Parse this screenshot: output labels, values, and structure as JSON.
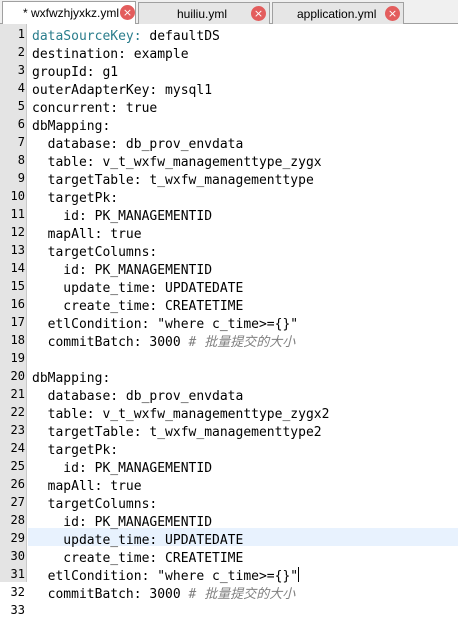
{
  "tabs": [
    {
      "label": "* wxfwzhjyxkz.yml",
      "close": "×",
      "active": true
    },
    {
      "label": "huiliu.yml",
      "close": "×",
      "active": false
    },
    {
      "label": "application.yml",
      "close": "×",
      "active": false
    }
  ],
  "lines": [
    {
      "n": "1",
      "key": "dataSourceKey:",
      "val": " defaultDS",
      "comment": ""
    },
    {
      "n": "2",
      "key": "destination:",
      "val": " example",
      "comment": ""
    },
    {
      "n": "3",
      "key": "groupId:",
      "val": " g1",
      "comment": ""
    },
    {
      "n": "4",
      "key": "outerAdapterKey:",
      "val": " mysql1",
      "comment": ""
    },
    {
      "n": "5",
      "key": "concurrent:",
      "val": " true",
      "comment": ""
    },
    {
      "n": "6",
      "key": "dbMapping:",
      "val": "",
      "comment": ""
    },
    {
      "n": "7",
      "key": "  database:",
      "val": " db_prov_envdata",
      "comment": ""
    },
    {
      "n": "8",
      "key": "  table:",
      "val": " v_t_wxfw_managementtype_zygx",
      "comment": ""
    },
    {
      "n": "9",
      "key": "  targetTable:",
      "val": " t_wxfw_managementtype",
      "comment": ""
    },
    {
      "n": "10",
      "key": "  targetPk:",
      "val": "",
      "comment": ""
    },
    {
      "n": "11",
      "key": "    id:",
      "val": " PK_MANAGEMENTID",
      "comment": ""
    },
    {
      "n": "12",
      "key": "  mapAll:",
      "val": " true",
      "comment": ""
    },
    {
      "n": "13",
      "key": "  targetColumns:",
      "val": "",
      "comment": ""
    },
    {
      "n": "14",
      "key": "    id:",
      "val": " PK_MANAGEMENTID",
      "comment": ""
    },
    {
      "n": "15",
      "key": "    update_time:",
      "val": " UPDATEDATE",
      "comment": ""
    },
    {
      "n": "16",
      "key": "    create_time:",
      "val": " CREATETIME",
      "comment": ""
    },
    {
      "n": "17",
      "key": "  etlCondition:",
      "val": " \"where c_time>={}\"",
      "comment": ""
    },
    {
      "n": "18",
      "key": "  commitBatch:",
      "val": " 3000 ",
      "comment": "# 批量提交的大小"
    },
    {
      "n": "19",
      "key": "",
      "val": "",
      "comment": ""
    },
    {
      "n": "20",
      "key": "dbMapping:",
      "val": "",
      "comment": ""
    },
    {
      "n": "21",
      "key": "  database:",
      "val": " db_prov_envdata",
      "comment": ""
    },
    {
      "n": "22",
      "key": "  table:",
      "val": " v_t_wxfw_managementtype_zygx2",
      "comment": ""
    },
    {
      "n": "23",
      "key": "  targetTable:",
      "val": " t_wxfw_managementtype2",
      "comment": ""
    },
    {
      "n": "24",
      "key": "  targetPk:",
      "val": "",
      "comment": ""
    },
    {
      "n": "25",
      "key": "    id:",
      "val": " PK_MANAGEMENTID",
      "comment": ""
    },
    {
      "n": "26",
      "key": "  mapAll:",
      "val": " true",
      "comment": ""
    },
    {
      "n": "27",
      "key": "  targetColumns:",
      "val": "",
      "comment": ""
    },
    {
      "n": "28",
      "key": "    id:",
      "val": " PK_MANAGEMENTID",
      "comment": ""
    },
    {
      "n": "29",
      "key": "    update_time:",
      "val": " UPDATEDATE",
      "comment": ""
    },
    {
      "n": "30",
      "key": "    create_time:",
      "val": " CREATETIME",
      "comment": ""
    },
    {
      "n": "31",
      "key": "  etlCondition:",
      "val": " \"where c_time>={}\"",
      "comment": ""
    },
    {
      "n": "32",
      "key": "  commitBatch:",
      "val": " 3000 ",
      "comment": "# 批量提交的大小"
    },
    {
      "n": "33",
      "key": "",
      "val": "",
      "comment": ""
    }
  ]
}
